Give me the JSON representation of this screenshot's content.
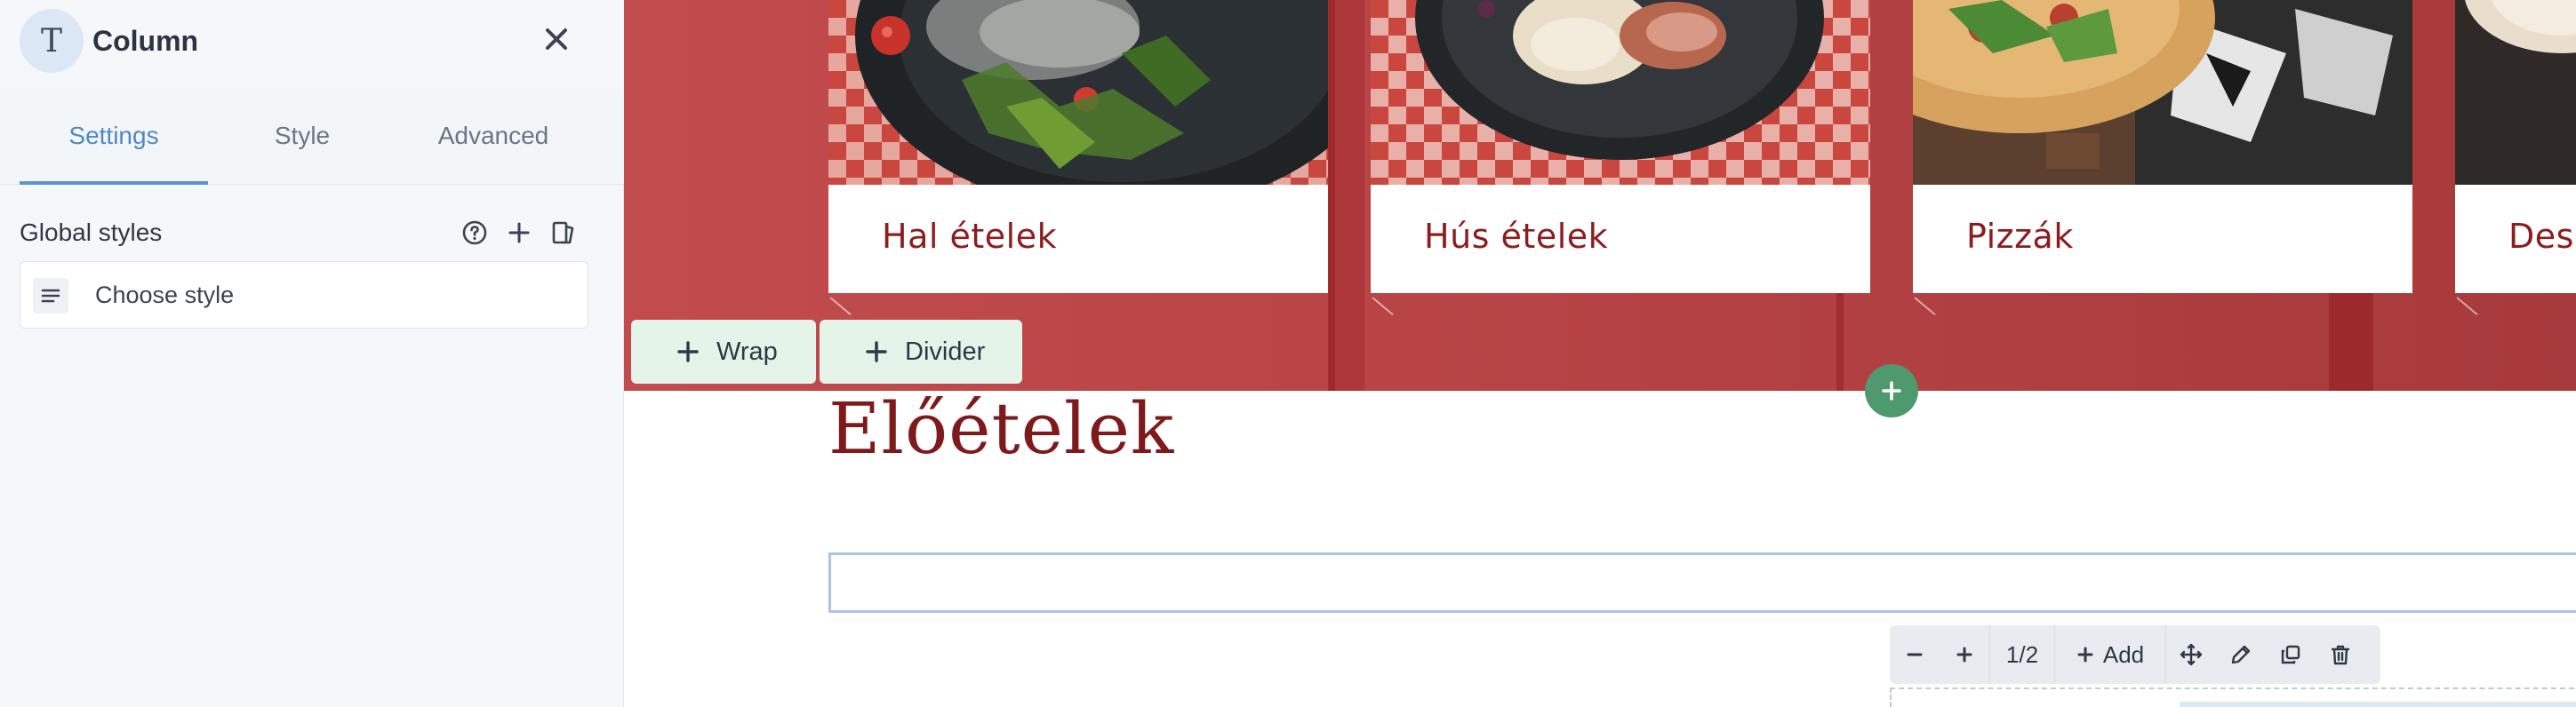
{
  "panel": {
    "avatar_letter": "T",
    "title": "Column",
    "tabs": [
      {
        "label": "Settings",
        "active": true
      },
      {
        "label": "Style",
        "active": false
      },
      {
        "label": "Advanced",
        "active": false
      }
    ],
    "global_styles": {
      "label": "Global styles",
      "select_placeholder": "Choose style"
    }
  },
  "canvas": {
    "cards": [
      {
        "title": "Hal ételek"
      },
      {
        "title": "Hús ételek"
      },
      {
        "title": "Pizzák"
      },
      {
        "title": "Dess"
      }
    ],
    "wrap_label": "Wrap",
    "divider_label": "Divider",
    "heading": "Előételek",
    "toolbar": {
      "fraction": "1/2",
      "add_label": "Add"
    }
  },
  "colors": {
    "hero": "#c24c4d",
    "card_title": "#8c1d1f",
    "heading": "#7f1a1c",
    "accent_tab": "#4f88c6",
    "add_circle": "#4e9a6e",
    "pill_bg": "#e4f4e9"
  }
}
